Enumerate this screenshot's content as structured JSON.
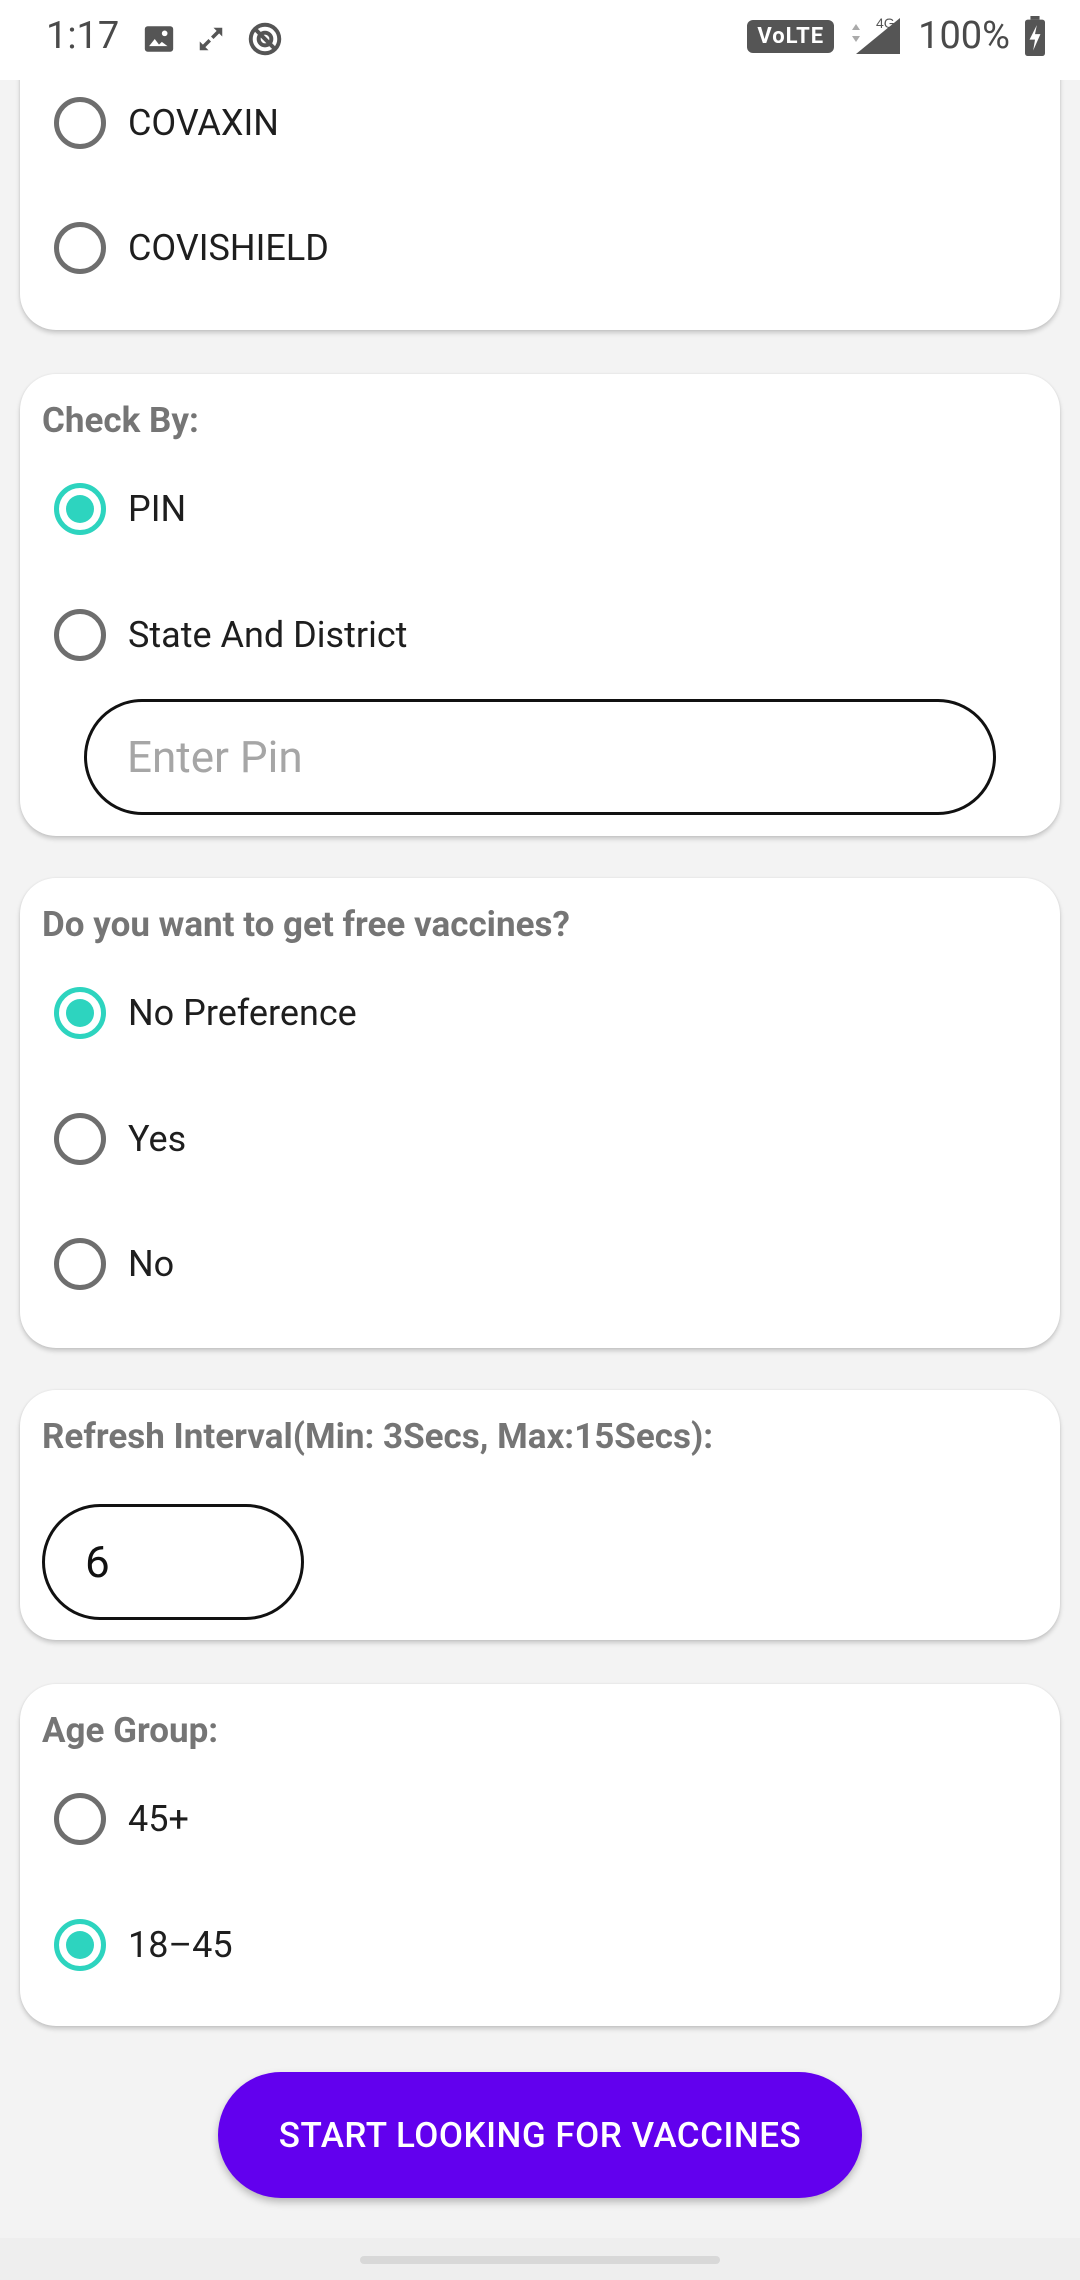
{
  "status_bar": {
    "time": "1:17",
    "volte": "VoLTE",
    "network": "4G",
    "battery": "100%"
  },
  "vaccine_card": {
    "options": [
      "COVAXIN",
      "COVISHIELD"
    ]
  },
  "check_by": {
    "title": "Check By:",
    "options": [
      "PIN",
      "State And District"
    ],
    "selected": "PIN",
    "pin_placeholder": "Enter Pin"
  },
  "free_vaccines": {
    "title": "Do you want to get free vaccines?",
    "options": [
      "No Preference",
      "Yes",
      "No"
    ],
    "selected": "No Preference"
  },
  "refresh": {
    "title": "Refresh Interval(Min: 3Secs, Max:15Secs):",
    "value": "6"
  },
  "age_group": {
    "title": "Age Group:",
    "options": [
      "45+",
      "18–45"
    ],
    "selected": "18–45"
  },
  "start_button": {
    "label": "START LOOKING FOR VACCINES"
  },
  "colors": {
    "accent": "#2dd4bf",
    "primary": "#6200ee"
  }
}
